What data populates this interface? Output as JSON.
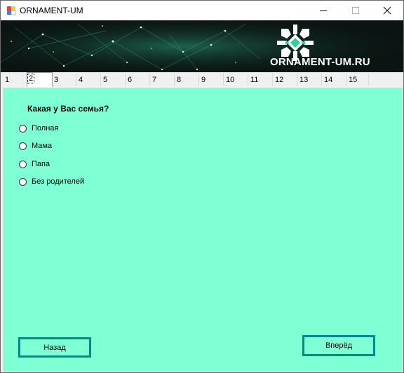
{
  "window": {
    "title": "ORNAMENT-UM"
  },
  "banner": {
    "logo_text": "ORNAMENT-UM.RU"
  },
  "tabs": [
    "1",
    "2",
    "3",
    "4",
    "5",
    "6",
    "7",
    "8",
    "9",
    "10",
    "11",
    "12",
    "13",
    "14",
    "15"
  ],
  "active_tab": "2",
  "question": {
    "text": "Какая у Вас семья?",
    "options": [
      "Полная",
      "Мама",
      "Папа",
      "Без родителей"
    ]
  },
  "buttons": {
    "back": "Назад",
    "next": "Вперёд"
  },
  "colors": {
    "panel_bg": "#7fffd4",
    "button_border": "#008b8b"
  }
}
